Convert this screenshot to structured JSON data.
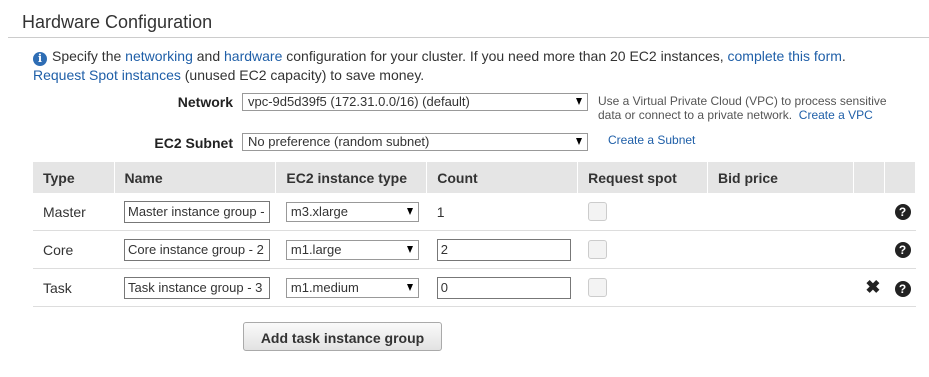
{
  "section": {
    "title": "Hardware Configuration"
  },
  "info": {
    "t1": "Specify the ",
    "networking_link": "networking",
    "t2": " and ",
    "hardware_link": "hardware",
    "t3": " configuration for your cluster. If you need more than 20 EC2 instances, ",
    "complete_form_link": "complete this form",
    "t4": ".",
    "spot_link": "Request Spot instances",
    "t5": " (unused EC2 capacity) to save money."
  },
  "network": {
    "label": "Network",
    "selected": "vpc-9d5d39f5 (172.31.0.0/16) (default)",
    "help_text": "Use a Virtual Private Cloud (VPC) to process sensitive data or connect to a private network.",
    "create_vpc_link": "Create a VPC"
  },
  "subnet": {
    "label": "EC2 Subnet",
    "selected": "No preference (random subnet)",
    "create_subnet_link": "Create a Subnet"
  },
  "table": {
    "headers": [
      "Type",
      "Name",
      "EC2 instance type",
      "Count",
      "Request spot",
      "Bid price"
    ],
    "rows": [
      {
        "type": "Master",
        "name": "Master instance group - ",
        "instance_type": "m3.xlarge",
        "count": "1"
      },
      {
        "type": "Core",
        "name": "Core instance group - 2",
        "instance_type": "m1.large",
        "count": "2"
      },
      {
        "type": "Task",
        "name": "Task instance group - 3",
        "instance_type": "m1.medium",
        "count": "0"
      }
    ]
  },
  "icons": {
    "help": "question-circle-icon",
    "remove": "close-icon",
    "info": "info-icon"
  },
  "buttons": {
    "add_task": "Add task instance group"
  }
}
